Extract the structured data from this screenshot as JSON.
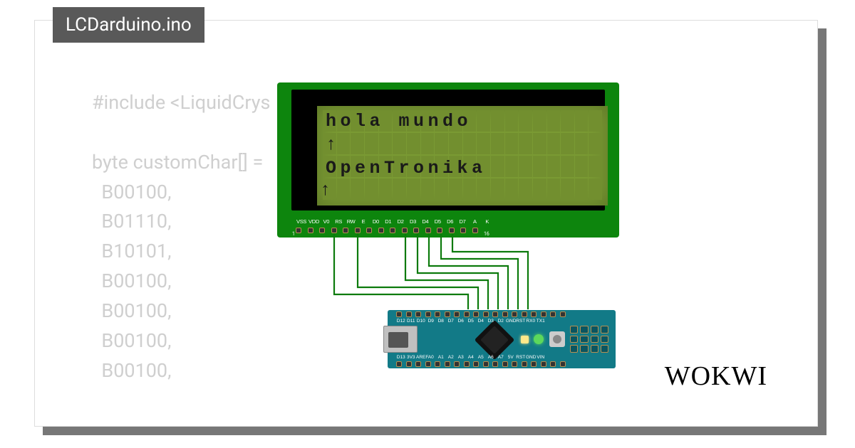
{
  "filename": "LCDarduino.ino",
  "code_lines": [
    "#include <LiquidCrys",
    "",
    "byte customChar[] = ",
    "  B00100,",
    "  B01110,",
    "  B10101,",
    "  B00100,",
    "  B00100,",
    "  B00100,",
    "  B00100,"
  ],
  "lcd": {
    "line1": "hola mundo",
    "line2": "↑",
    "line3": "OpenTronika",
    "line4": "↑",
    "pin_labels": [
      "VSS",
      "VDD",
      "V0",
      "RS",
      "RW",
      "E",
      "D0",
      "D1",
      "D2",
      "D3",
      "D4",
      "D5",
      "D6",
      "D7",
      "A",
      "K"
    ],
    "pin_left": "1",
    "pin_right": "16"
  },
  "nano": {
    "top_labels": [
      "D12",
      "D11",
      "D10",
      "D9",
      "D8",
      "D7",
      "D6",
      "D5",
      "D4",
      "D3",
      "D2",
      "GND",
      "RST",
      "RX0",
      "TX1"
    ],
    "bot_labels": [
      "D13",
      "3V3",
      "AREF",
      "A0",
      "A1",
      "A2",
      "A3",
      "A4",
      "A5",
      "A6",
      "A7",
      "5V",
      "RST",
      "GND",
      "VIN"
    ]
  },
  "brand": "WOKWI"
}
